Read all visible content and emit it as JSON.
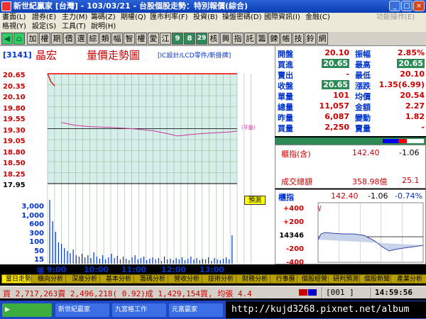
{
  "window": {
    "title": "新世紀贏家 [台灣] - 103/03/21 - 台股個股走勢：特別報價(綜合)"
  },
  "menu": {
    "row1": [
      "畫面(L)",
      "證券(E)",
      "主力(M)",
      "籌碼(Z)",
      "期權(Q)",
      "匯市利率(F)",
      "投資(B)",
      "操盤密碼(D)",
      "國際資訊(I)",
      "金融(C)",
      "功能操作(E)"
    ],
    "row2": [
      "格視(Y)",
      "設定(S)",
      "工具(T)",
      "說明(H)"
    ]
  },
  "toolbar": {
    "buttons": [
      "加",
      "權",
      "期",
      "價",
      "選",
      "綜",
      "類",
      "幅",
      "智",
      "權",
      "愛",
      "江",
      "9",
      "8",
      "29",
      "核",
      "興",
      "指",
      "託",
      "籌",
      "鍊",
      "帳",
      "技",
      "鈴",
      "網"
    ]
  },
  "chart": {
    "code": "[3141]",
    "name": "晶宏",
    "title": "量價走勢圖",
    "industry": "[IC設計/LCD零件/新掛牌]",
    "price_labels": [
      "20.65",
      "20.35",
      "20.10",
      "19.80",
      "19.55",
      "19.30",
      "19.05",
      "18.80",
      "18.50",
      "18.25",
      "17.95"
    ],
    "volume_labels": [
      "3,000",
      "1,000",
      "600",
      "300",
      "100",
      "50",
      "15",
      "張"
    ],
    "time_labels": [
      "9:00",
      "10:00",
      "11:00",
      "12:00",
      "13:00"
    ],
    "predict_label": "預測",
    "ref_tag": "(平盤)"
  },
  "chart_data": {
    "type": "line",
    "x": [
      "9:00",
      "9:05",
      "9:10",
      "9:20",
      "9:40",
      "10:00",
      "10:30",
      "11:00",
      "11:30",
      "11:50",
      "12:05",
      "12:20",
      "12:40",
      "13:00",
      "13:20",
      "13:30"
    ],
    "series": [
      {
        "values": [
          20.65,
          20.45,
          20.35,
          19.45,
          19.38,
          19.35,
          19.33,
          19.3,
          19.25,
          19.18,
          19.12,
          19.15,
          19.18,
          19.2,
          19.22,
          19.24
        ]
      }
    ],
    "ylim": [
      17.95,
      20.65
    ],
    "ylabel": "",
    "xlabel": ""
  },
  "quote": {
    "rows": [
      {
        "l1": "開盤",
        "v1": "20.10",
        "b1": false,
        "l2": "振幅",
        "v2": "2.85%",
        "b2": false
      },
      {
        "l1": "買進",
        "v1": "20.65",
        "b1": true,
        "l2": "最高",
        "v2": "20.65",
        "b2": true
      },
      {
        "l1": "賣出",
        "v1": "-",
        "b1": false,
        "l2": "最低",
        "v2": "20.10",
        "b2": false
      },
      {
        "l1": "收盤",
        "v1": "20.65",
        "b1": true,
        "l2": "漲跌",
        "v2": "1.35(6.99)",
        "b2": false
      },
      {
        "l1": "單量",
        "v1": "101",
        "b1": false,
        "l2": "均價",
        "v2": "20.54",
        "b2": false
      },
      {
        "l1": "總量",
        "v1": "11,057",
        "b1": false,
        "l2": "金額",
        "v2": "2.27",
        "b2": false
      },
      {
        "l1": "昨量",
        "v1": "6,087",
        "b1": false,
        "l2": "變動",
        "v2": "1.82",
        "b2": false
      },
      {
        "l1": "買量",
        "v1": "2,250",
        "b1": false,
        "l2": "賣量",
        "v2": "-",
        "b2": false
      }
    ],
    "colors": {
      "up": "#cc0000",
      "label": "#0033cc",
      "box": "#2e8b57"
    }
  },
  "index": {
    "label": "櫃指(含)",
    "value": "142.40",
    "change": "-1.06",
    "total_label": "成交總額",
    "total_value": "358.98億",
    "total_ratio": "25.1"
  },
  "mini": {
    "label": "櫃指",
    "value": "142.40",
    "change": "-1.06",
    "pct": "-0.74%",
    "y_labels": [
      "+400",
      "+200",
      "14346",
      "-200",
      "-400"
    ]
  },
  "tabs": [
    "當日走勢",
    "橫向分析",
    "深度分析",
    "基本分析",
    "籌碼分析",
    "營收分析",
    "技術分析",
    "財務分析",
    "行事曆",
    "個股經營",
    "研判預測",
    "個股新聞",
    "產業分析"
  ],
  "status": {
    "text": "買 2,717,263賣 2,496,218( 0.92)成 1,429,154買, 均張 4.4",
    "code": "[001    ]",
    "time": "14:59:56"
  },
  "taskbar": {
    "buttons": [
      "新世紀贏家",
      "九宮格工作",
      "元富贏家"
    ],
    "url": "http://kujd3268.pixnet.net/album"
  }
}
